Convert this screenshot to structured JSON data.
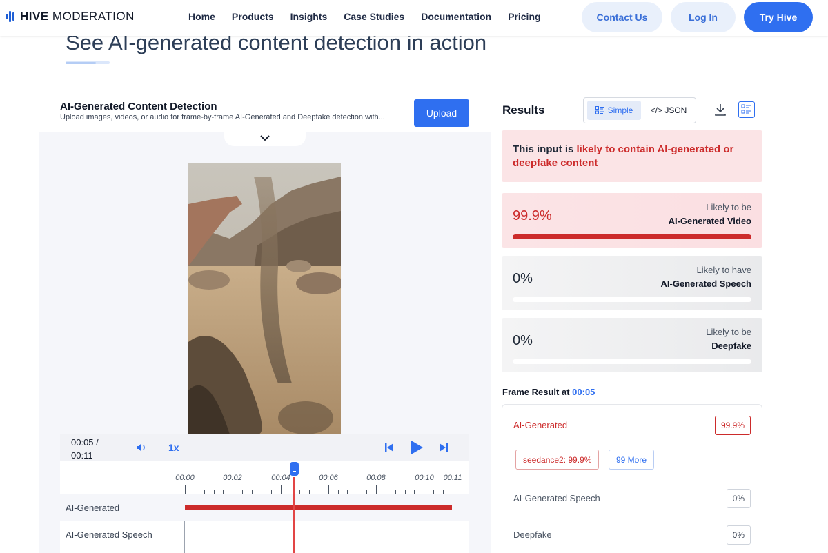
{
  "brand": {
    "bold": "HIVE",
    "rest": " MODERATION"
  },
  "nav": {
    "links": [
      "Home",
      "Products",
      "Insights",
      "Case Studies",
      "Documentation",
      "Pricing"
    ],
    "contact": "Contact Us",
    "login": "Log In",
    "try": "Try Hive"
  },
  "headline": "See AI-generated content detection in action",
  "panel": {
    "title": "AI-Generated Content Detection",
    "subtitle": "Upload images, videos, or audio for frame-by-frame AI-Generated and Deepfake detection with...",
    "upload": "Upload"
  },
  "player": {
    "current": "00:05 /",
    "total": "00:11",
    "speed": "1x",
    "timeline_labels": [
      "00:00",
      "00:02",
      "00:04",
      "00:06",
      "00:08",
      "00:10",
      "00:11"
    ],
    "tracks": [
      "AI-Generated",
      "AI-Generated Speech"
    ]
  },
  "results": {
    "title": "Results",
    "view_simple": "Simple",
    "view_json": "</> JSON",
    "verdict_prefix": "This input is ",
    "verdict_highlight": "likely to contain AI-generated or deepfake content",
    "cards": [
      {
        "pct": "99.9%",
        "cap1": "Likely to be",
        "cap2": "AI-Generated Video",
        "fill": 1.0
      },
      {
        "pct": "0%",
        "cap1": "Likely to have",
        "cap2": "AI-Generated Speech",
        "fill": 0
      },
      {
        "pct": "0%",
        "cap1": "Likely to be",
        "cap2": "Deepfake",
        "fill": 0
      }
    ],
    "frame_prefix": "Frame Result at ",
    "frame_time": "00:05",
    "frame_rows": {
      "ai_label": "AI-Generated",
      "ai_value": "99.9%",
      "tag_model": "seedance2: 99.9%",
      "tag_more": "99 More",
      "speech_label": "AI-Generated Speech",
      "speech_value": "0%",
      "deepfake_label": "Deepfake",
      "deepfake_value": "0%"
    }
  },
  "colors": {
    "accent": "#2f6ff0",
    "alert": "#cc2b2b",
    "alert_bg": "#fbe4e6"
  }
}
